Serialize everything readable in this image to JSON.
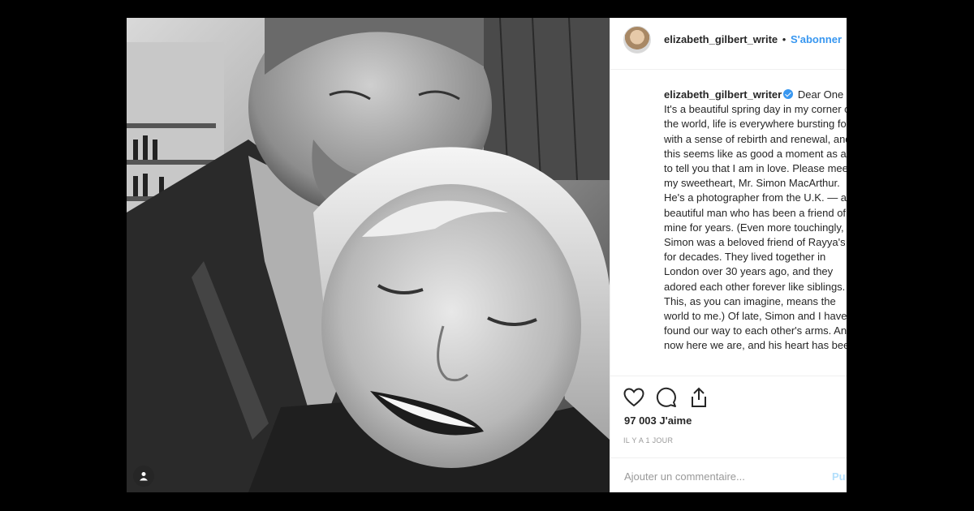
{
  "post": {
    "username": "elizabeth_gilbert_write",
    "follow_label": "S'abonner",
    "separator": "•",
    "caption_username": "elizabeth_gilbert_writer",
    "caption_text": "Dear One It's a beautiful spring day in my corner of the world, life is everywhere bursting forth with a sense of rebirth and renewal, and this seems like as good a moment as any to tell you that I am in love. Please meet my sweetheart, Mr. Simon MacArthur. He's a photographer from the U.K. — a beautiful man who has been a friend of mine for years. (Even more touchingly, Simon was a beloved friend of Rayya's for decades. They lived together in London over 30 years ago, and they adored each other forever like siblings. This, as you can imagine, means the world to me.) Of late, Simon and I have found our way to each other's arms. And now here we are, and his heart has been",
    "likes": "97 003 J'aime",
    "time_ago": "IL Y A 1 JOUR",
    "comment_placeholder": "Ajouter un commentaire...",
    "publish_label": "Pu"
  },
  "icons": [
    "user-tag-icon",
    "heart-icon",
    "comment-icon",
    "share-icon",
    "verified-icon"
  ]
}
